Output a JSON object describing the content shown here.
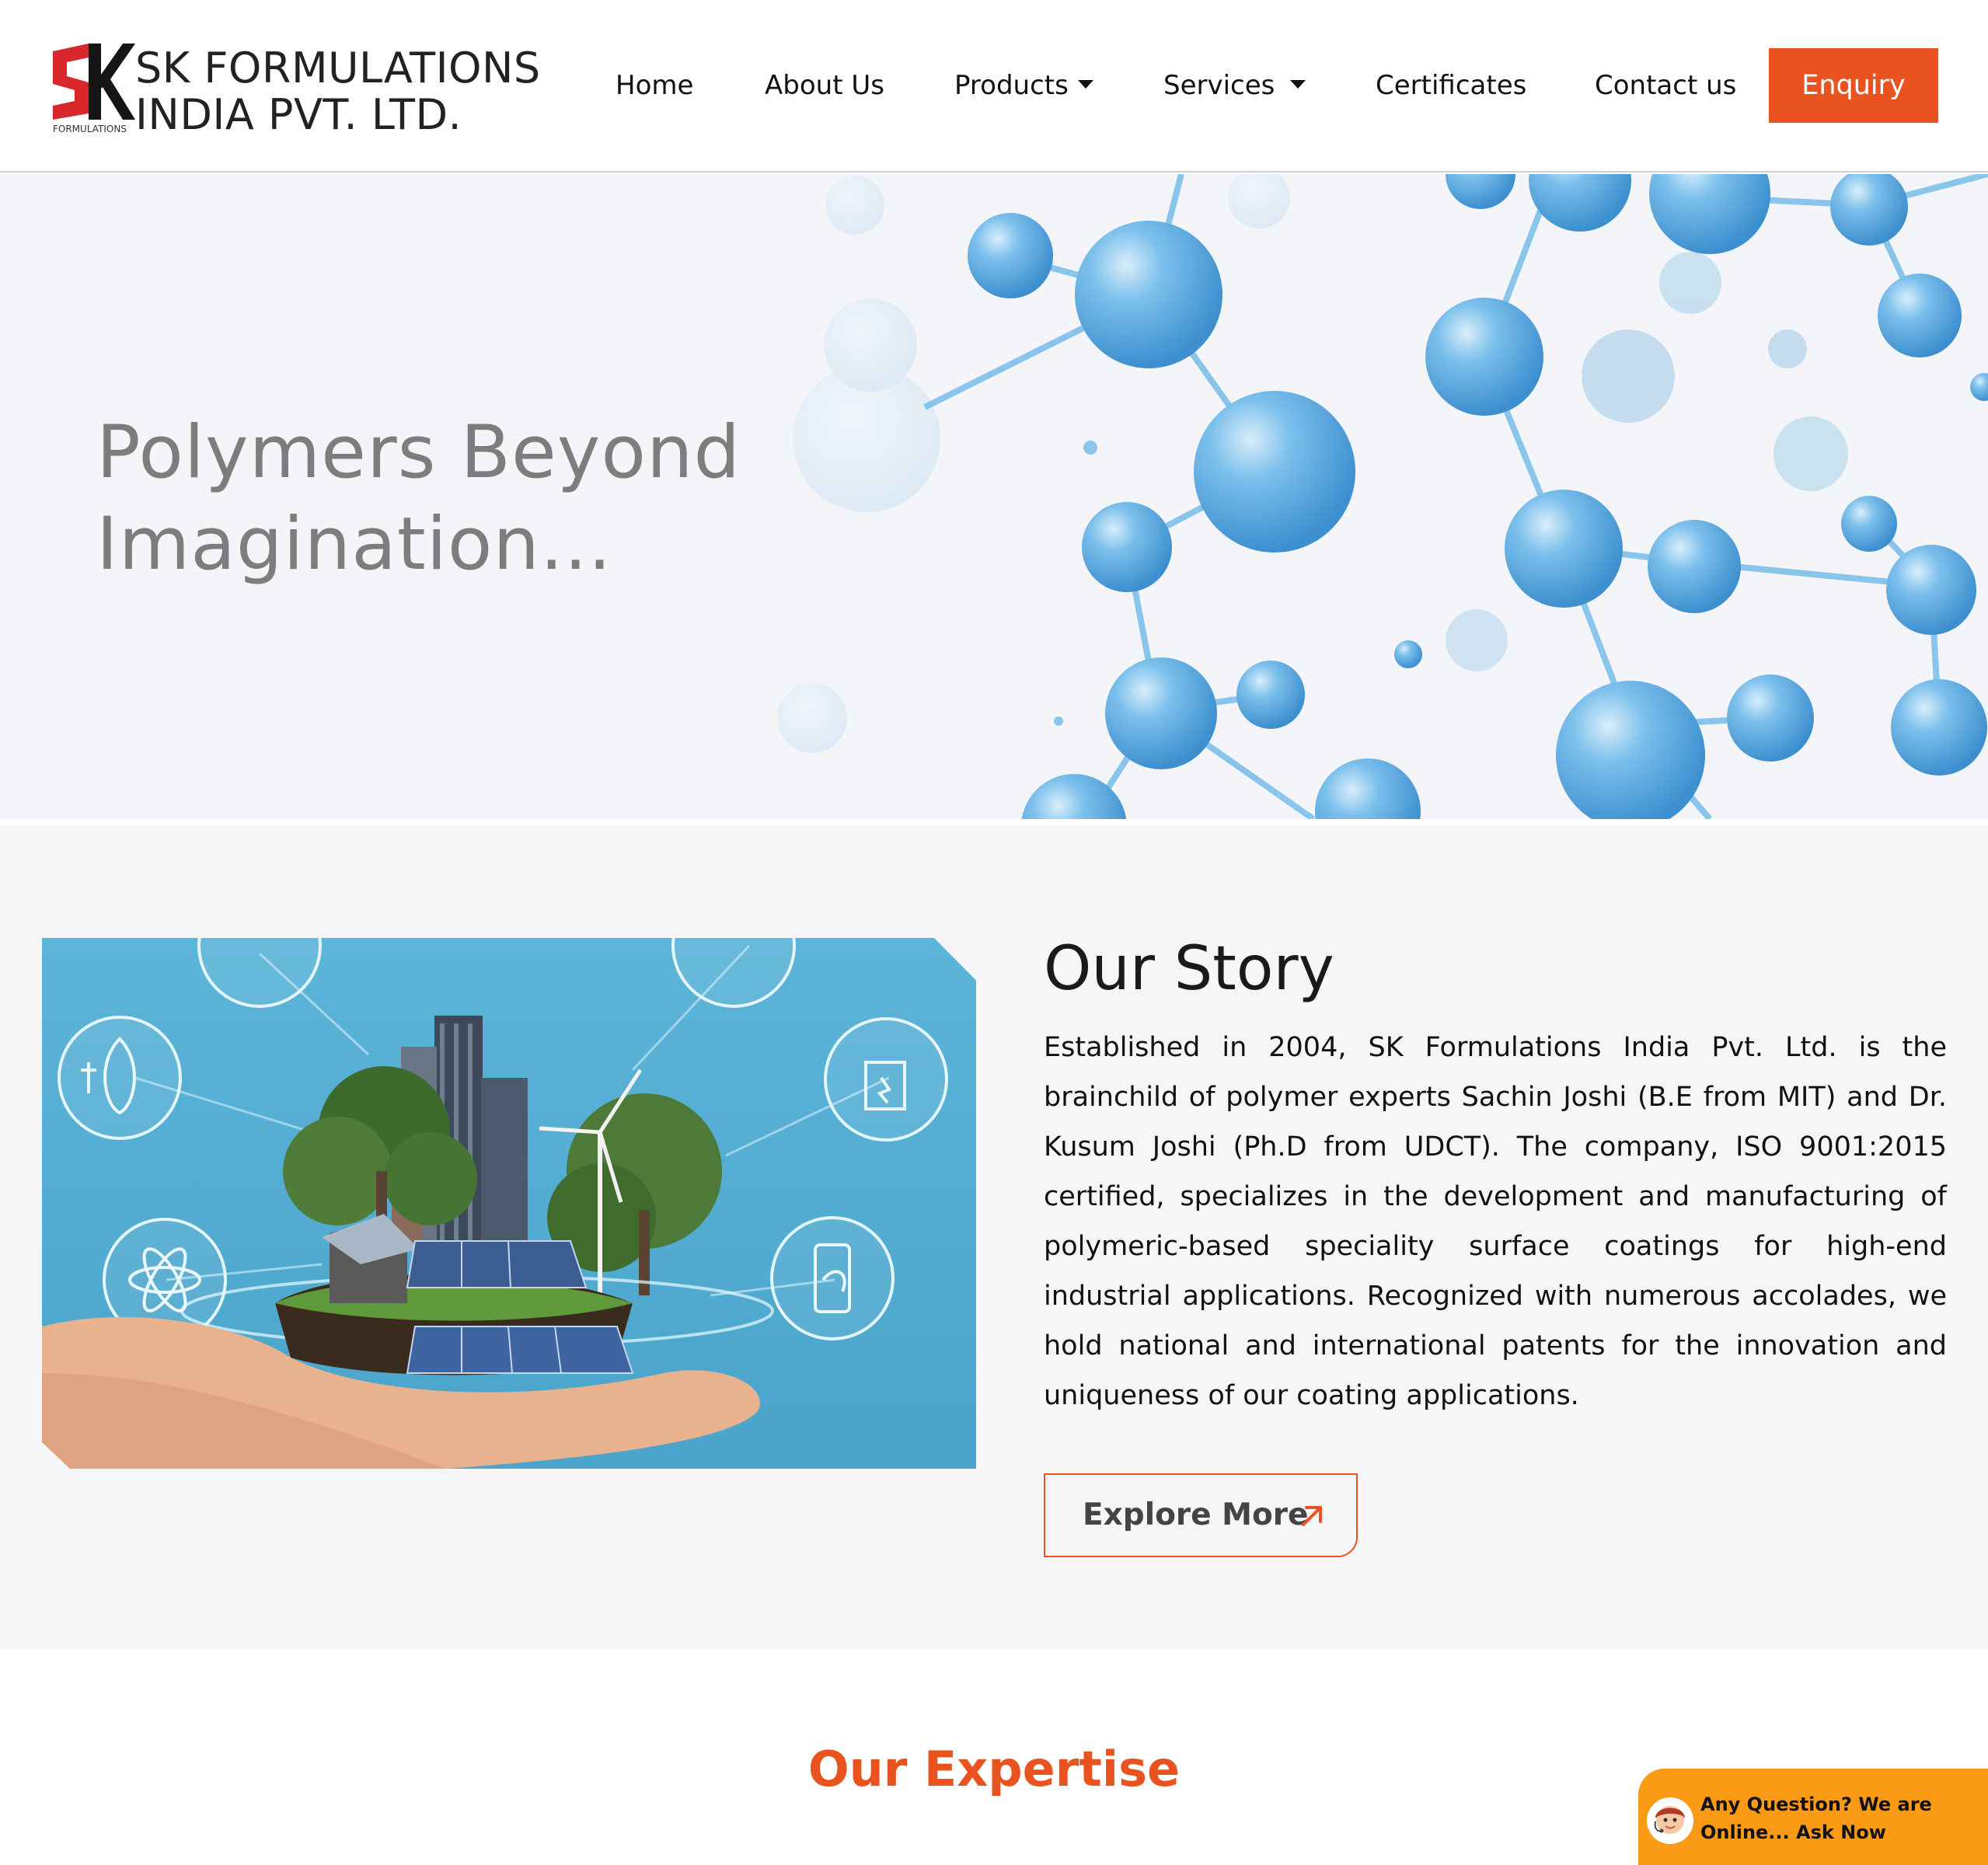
{
  "brand": {
    "logo_mark": "SK",
    "logo_sub": "FORMULATIONS",
    "line1": "SK FORMULATIONS",
    "line2": "INDIA PVT. LTD.",
    "accent_color": "#e8531f",
    "logo_red": "#d8282c"
  },
  "nav": {
    "items": [
      {
        "label": "Home",
        "has_dropdown": false
      },
      {
        "label": "About Us",
        "has_dropdown": false
      },
      {
        "label": "Products",
        "has_dropdown": true
      },
      {
        "label": "Services",
        "has_dropdown": true
      },
      {
        "label": "Certificates",
        "has_dropdown": false
      },
      {
        "label": "Contact us",
        "has_dropdown": false
      }
    ],
    "cta": "Enquiry"
  },
  "hero": {
    "title_line1": "Polymers Beyond",
    "title_line2": "Imagination...",
    "molecule_color": "#5aaee2"
  },
  "story": {
    "title": "Our Story",
    "paragraph": "Established in 2004, SK Formulations India Pvt. Ltd. is the brainchild of polymer experts Sachin Joshi (B.E from MIT) and Dr. Kusum Joshi (Ph.D from UDCT). The company, ISO 9001:2015 certified, specializes in the development and manufacturing of polymeric-based speciality surface coatings for high-end industrial applications. Recognized with numerous accolades, we hold national and international patents for the innovation and uniqueness of our coating applications.",
    "button": "Explore More",
    "button_icon": "arrow-up-right-icon"
  },
  "expertise": {
    "title": "Our Expertise"
  },
  "chat": {
    "text_line1": "Any Question? We are",
    "text_line2": "Online... Ask Now",
    "icon": "support-agent-icon",
    "bg_color": "#fb9a14"
  }
}
